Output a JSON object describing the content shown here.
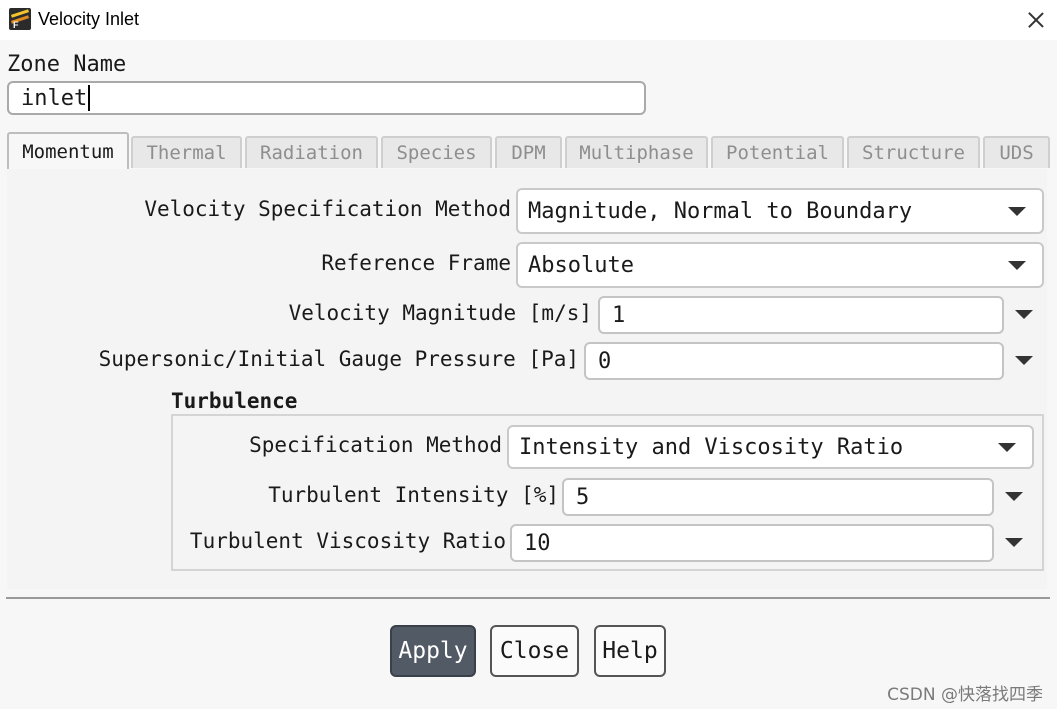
{
  "window": {
    "title": "Velocity Inlet",
    "close_icon": "close-icon",
    "app_icon": "fluent-app-icon"
  },
  "zone": {
    "label": "Zone Name",
    "value": "inlet"
  },
  "tabs": [
    {
      "label": "Momentum",
      "active": true
    },
    {
      "label": "Thermal",
      "active": false
    },
    {
      "label": "Radiation",
      "active": false
    },
    {
      "label": "Species",
      "active": false
    },
    {
      "label": "DPM",
      "active": false
    },
    {
      "label": "Multiphase",
      "active": false
    },
    {
      "label": "Potential",
      "active": false
    },
    {
      "label": "Structure",
      "active": false
    },
    {
      "label": "UDS",
      "active": false
    }
  ],
  "momentum": {
    "velocity_method": {
      "label": "Velocity Specification Method",
      "value": "Magnitude, Normal to Boundary"
    },
    "reference_frame": {
      "label": "Reference Frame",
      "value": "Absolute"
    },
    "velocity_magnitude": {
      "label": "Velocity Magnitude [m/s]",
      "value": "1"
    },
    "gauge_pressure": {
      "label": "Supersonic/Initial Gauge Pressure [Pa]",
      "value": "0"
    }
  },
  "turbulence": {
    "heading": "Turbulence",
    "spec_method": {
      "label": "Specification Method",
      "value": "Intensity and Viscosity Ratio"
    },
    "intensity": {
      "label": "Turbulent Intensity [%]",
      "value": "5"
    },
    "viscosity_ratio": {
      "label": "Turbulent Viscosity Ratio",
      "value": "10"
    }
  },
  "buttons": {
    "apply": "Apply",
    "close": "Close",
    "help": "Help"
  },
  "watermark": "CSDN @快落找四季",
  "colors": {
    "primary_button": "#525a66",
    "tab_inactive_text": "#8e8e8e"
  }
}
